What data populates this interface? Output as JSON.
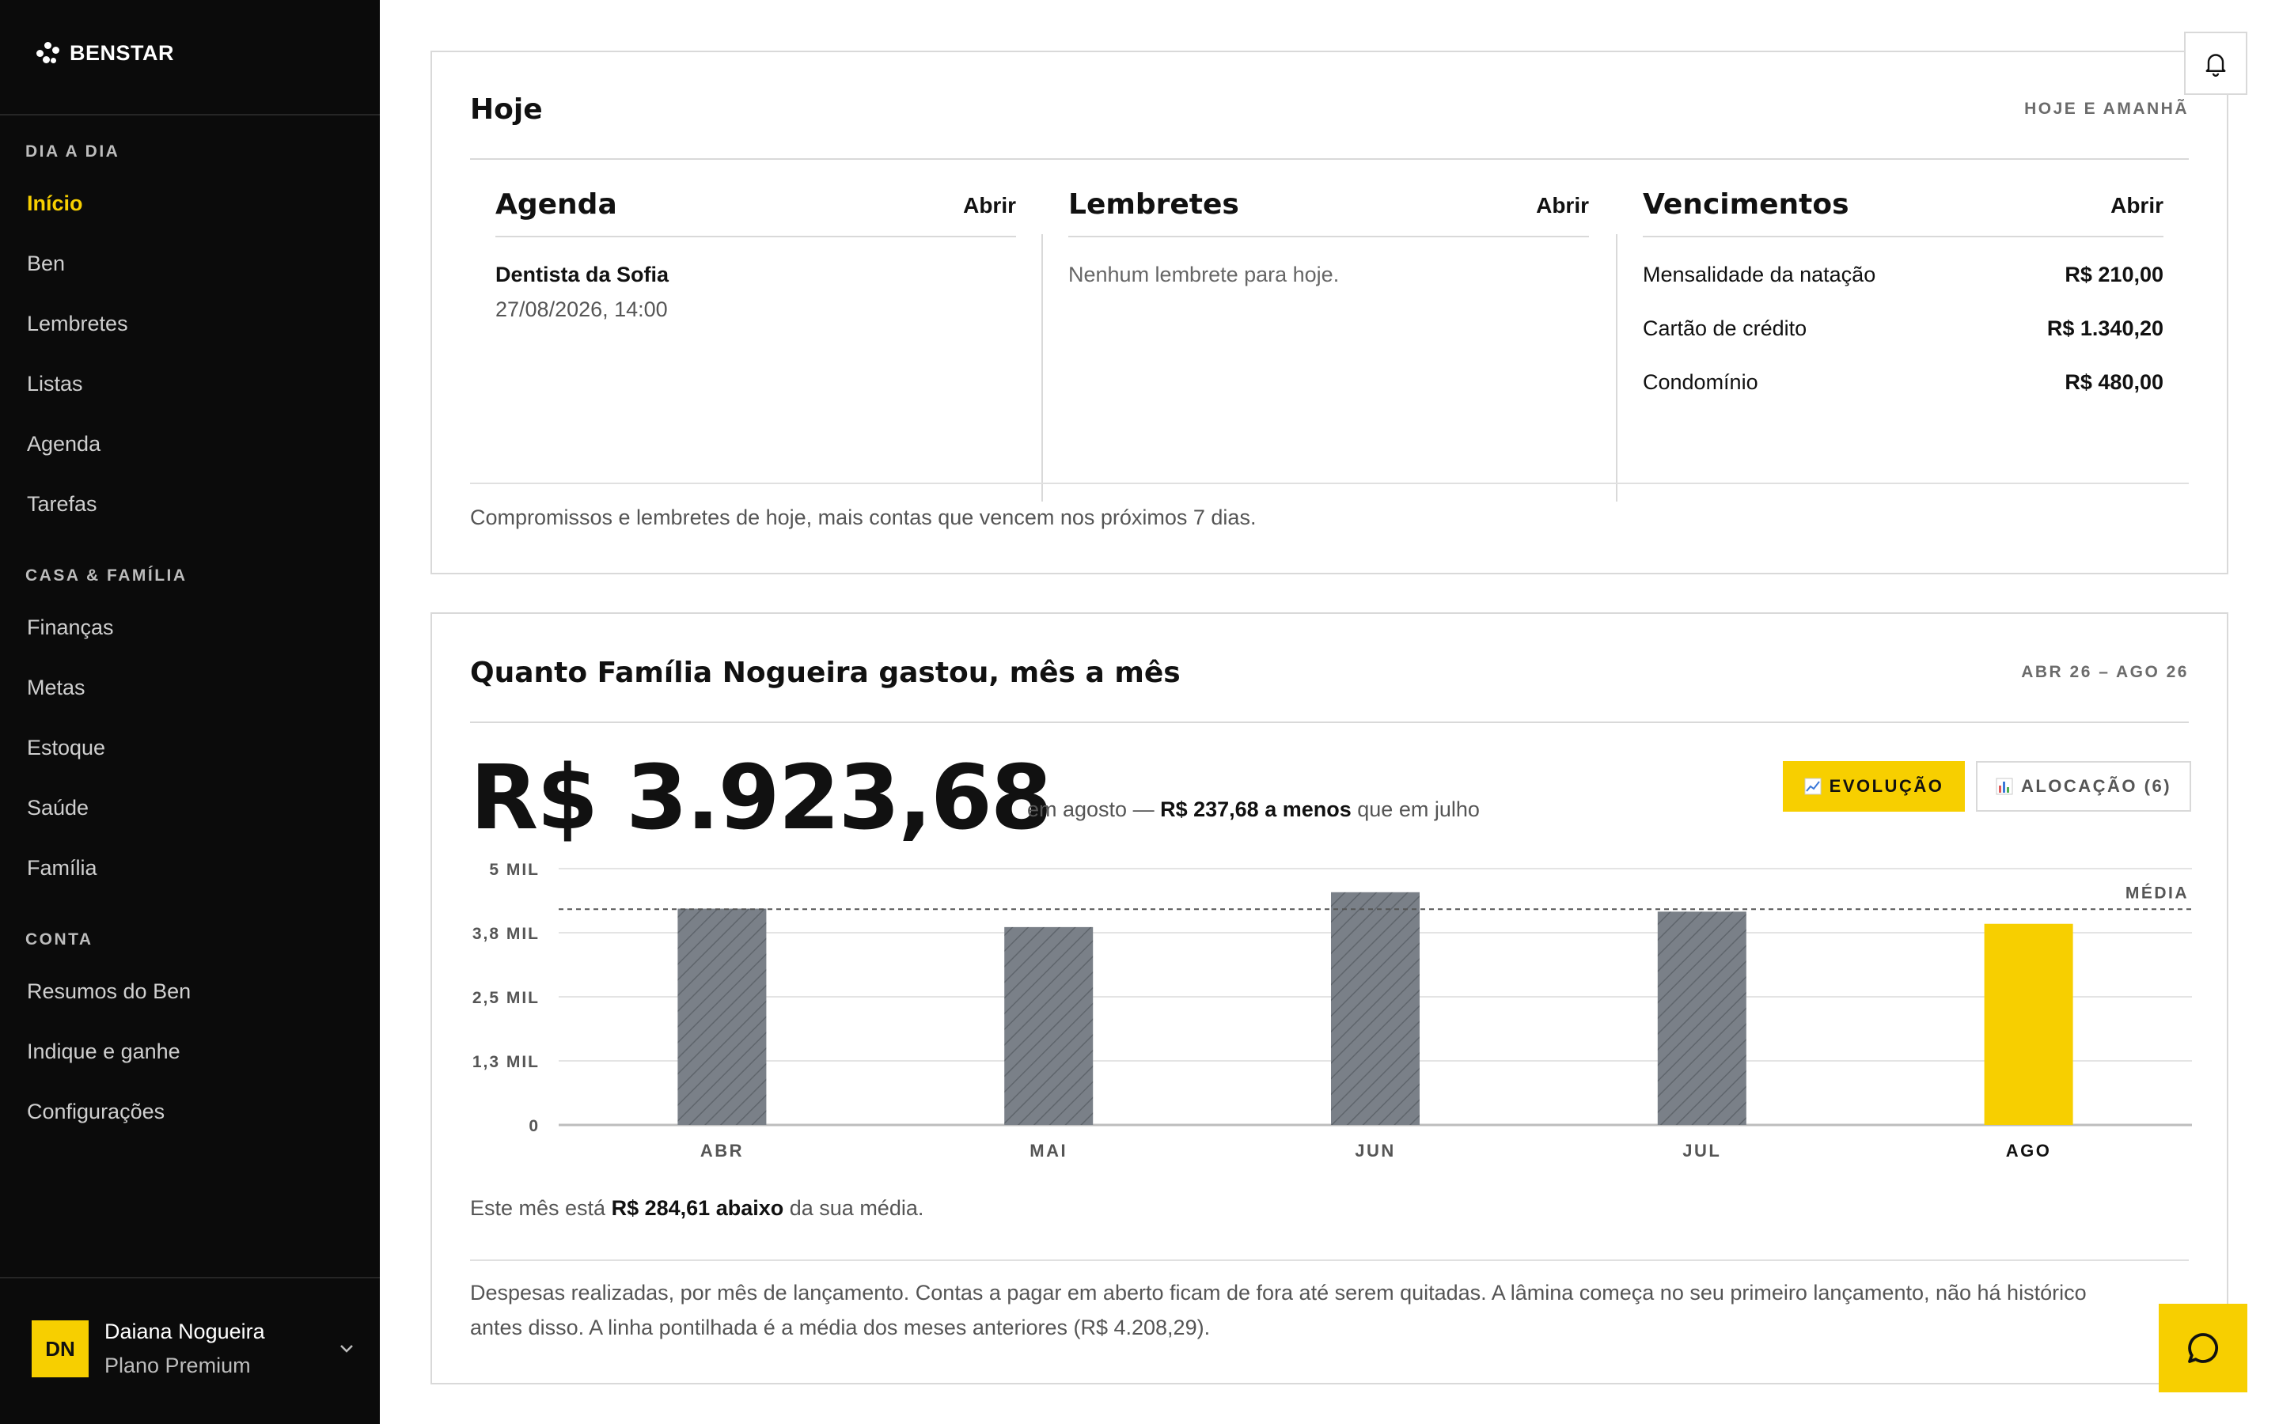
{
  "app": {
    "brand": "BENSTAR"
  },
  "sidebar": {
    "sections": [
      {
        "label": "DIA A DIA",
        "items": [
          "Início",
          "Ben",
          "Lembretes",
          "Listas",
          "Agenda",
          "Tarefas"
        ]
      },
      {
        "label": "CASA & FAMÍLIA",
        "items": [
          "Finanças",
          "Metas",
          "Estoque",
          "Saúde",
          "Família"
        ]
      },
      {
        "label": "CONTA",
        "items": [
          "Resumos do Ben",
          "Indique e ganhe",
          "Configurações"
        ]
      }
    ],
    "active_item": "Início",
    "user": {
      "initials": "DN",
      "name": "Daiana Nogueira",
      "plan": "Plano Premium"
    }
  },
  "today": {
    "title": "Hoje",
    "tag": "HOJE E AMANHÃ",
    "agenda": {
      "title": "Agenda",
      "open": "Abrir",
      "event_title": "Dentista da Sofia",
      "event_time": "27/08/2026, 14:00"
    },
    "reminders": {
      "title": "Lembretes",
      "open": "Abrir",
      "empty": "Nenhum lembrete para hoje."
    },
    "dues": {
      "title": "Vencimentos",
      "open": "Abrir",
      "items": [
        {
          "label": "Mensalidade da natação",
          "amount": "R$ 210,00"
        },
        {
          "label": "Cartão de crédito",
          "amount": "R$ 1.340,20"
        },
        {
          "label": "Condomínio",
          "amount": "R$ 480,00"
        }
      ]
    },
    "footer": "Compromissos e lembretes de hoje, mais contas que vencem nos próximos 7 dias."
  },
  "spending": {
    "title": "Quanto Família Nogueira gastou, mês a mês",
    "range": "ABR 26 – AGO 26",
    "amount": "R$ 3.923,68",
    "compare_pre": "em agosto —",
    "compare_bold": "R$ 237,68 a menos",
    "compare_post": "que em julho",
    "btn_evolution": "EVOLUÇÃO",
    "btn_allocation": "ALOCAÇÃO (6)",
    "note_pre": "Este mês está",
    "note_bold": "R$ 284,61 abaixo",
    "note_post": "da sua média.",
    "footer_line1": "Despesas realizadas, por mês de lançamento. Contas a pagar em aberto ficam de fora até serem quitadas. A lâmina começa no seu primeiro lançamento, não há histórico",
    "footer_line2": "antes disso. A linha pontilhada é a média dos meses anteriores (R$ 4.208,29)."
  },
  "chart_data": {
    "type": "bar",
    "categories": [
      "ABR",
      "MAI",
      "JUN",
      "JUL",
      "AGO"
    ],
    "values": [
      4220,
      3860,
      4540,
      4161.36,
      3923.68
    ],
    "highlight_category": "AGO",
    "ylim": [
      0,
      5000
    ],
    "y_ticks": [
      "0",
      "1,3 MIL",
      "2,5 MIL",
      "3,8 MIL",
      "5 MIL"
    ],
    "y_tick_values": [
      0,
      1250,
      2500,
      3750,
      5000
    ],
    "average": 4208.29,
    "average_label": "MÉDIA",
    "grid": true,
    "colors": {
      "bar": "#7a8088",
      "highlight": "#f7cf00",
      "grid": "#e4e4e4",
      "axis": "#bdbdbd"
    }
  }
}
